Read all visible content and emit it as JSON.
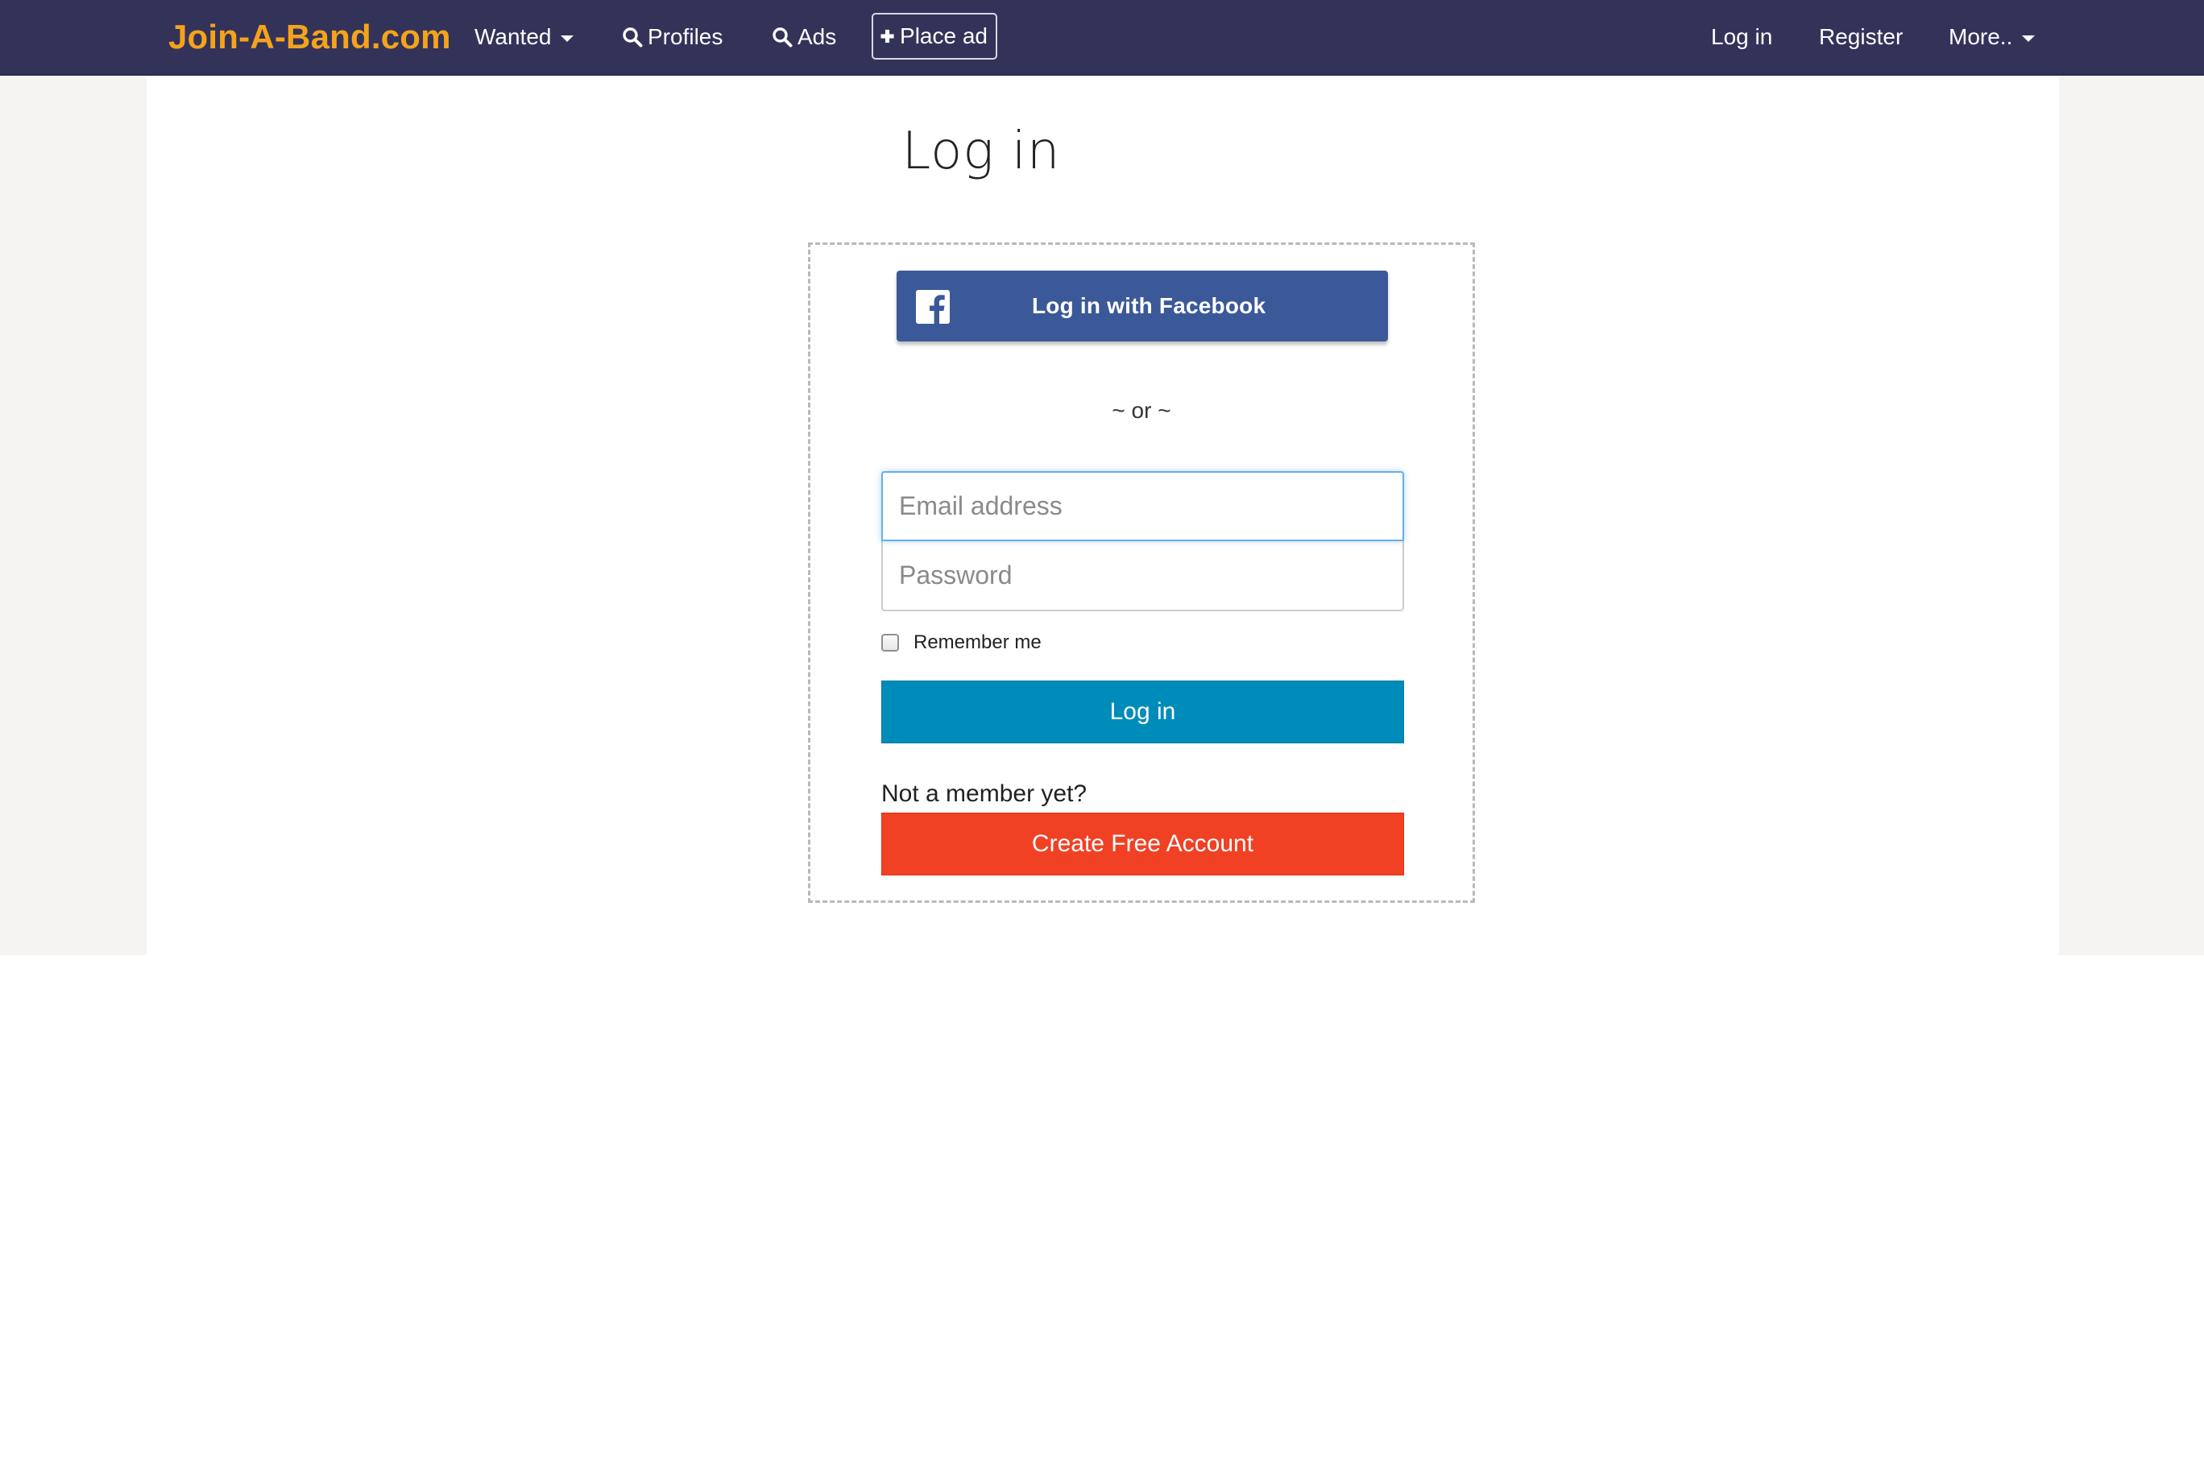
{
  "navbar": {
    "brand": "Join-A-Band.com",
    "wanted_label": "Wanted",
    "profiles_label": "Profiles",
    "ads_label": "Ads",
    "place_ad_label": "Place ad",
    "login_label": "Log in",
    "register_label": "Register",
    "more_label": "More..",
    "colors": {
      "background": "#33335a",
      "brand": "#f5a31a"
    },
    "icons": {
      "wanted": "caret-down-icon",
      "profiles": "search-icon",
      "ads": "search-icon",
      "place_ad": "plus-icon",
      "more": "caret-down-icon"
    }
  },
  "page": {
    "title": "Log in"
  },
  "login": {
    "facebook_label": "Log in with Facebook",
    "facebook_icon": "facebook-icon",
    "or_text": "~ or ~",
    "email": {
      "value": "",
      "placeholder": "Email address"
    },
    "password": {
      "value": "",
      "placeholder": "Password"
    },
    "remember_label": "Remember me",
    "remember_checked": false,
    "submit_label": "Log in",
    "not_member_text": "Not a member yet?",
    "create_account_label": "Create Free Account",
    "colors": {
      "facebook": "#3b5998",
      "login_button": "#008cba",
      "create_button": "#f04124"
    }
  }
}
